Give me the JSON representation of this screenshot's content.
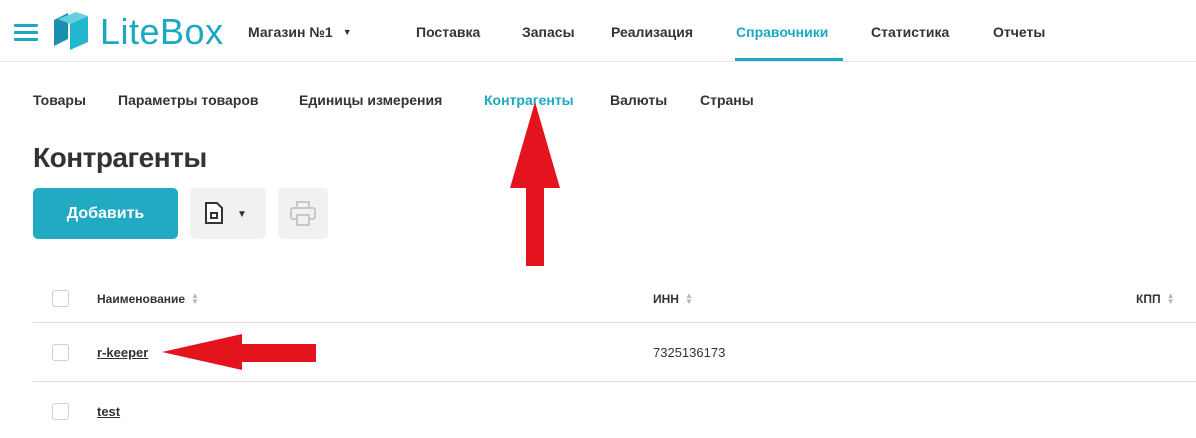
{
  "app": {
    "logo_text": "LiteBox",
    "store_name": "Магазин №1"
  },
  "main_nav": [
    {
      "label": "Поставка",
      "active": false
    },
    {
      "label": "Запасы",
      "active": false
    },
    {
      "label": "Реализация",
      "active": false
    },
    {
      "label": "Справочники",
      "active": true
    },
    {
      "label": "Статистика",
      "active": false
    },
    {
      "label": "Отчеты",
      "active": false
    }
  ],
  "sub_nav": [
    {
      "label": "Товары",
      "active": false
    },
    {
      "label": "Параметры товаров",
      "active": false
    },
    {
      "label": "Единицы измерения",
      "active": false
    },
    {
      "label": "Контрагенты",
      "active": true
    },
    {
      "label": "Валюты",
      "active": false
    },
    {
      "label": "Страны",
      "active": false
    }
  ],
  "page": {
    "title": "Контрагенты"
  },
  "toolbar": {
    "add_label": "Добавить",
    "export_icon": "document-icon",
    "print_icon": "printer-icon"
  },
  "table": {
    "columns": [
      "Наименование",
      "ИНН",
      "КПП"
    ],
    "rows": [
      {
        "name": "r-keeper",
        "inn": "7325136173",
        "kpp": ""
      },
      {
        "name": "test",
        "inn": "",
        "kpp": ""
      }
    ]
  },
  "colors": {
    "accent": "#1aa8c2",
    "annotation": "#e3141d",
    "button_bg": "#eff1f3"
  }
}
